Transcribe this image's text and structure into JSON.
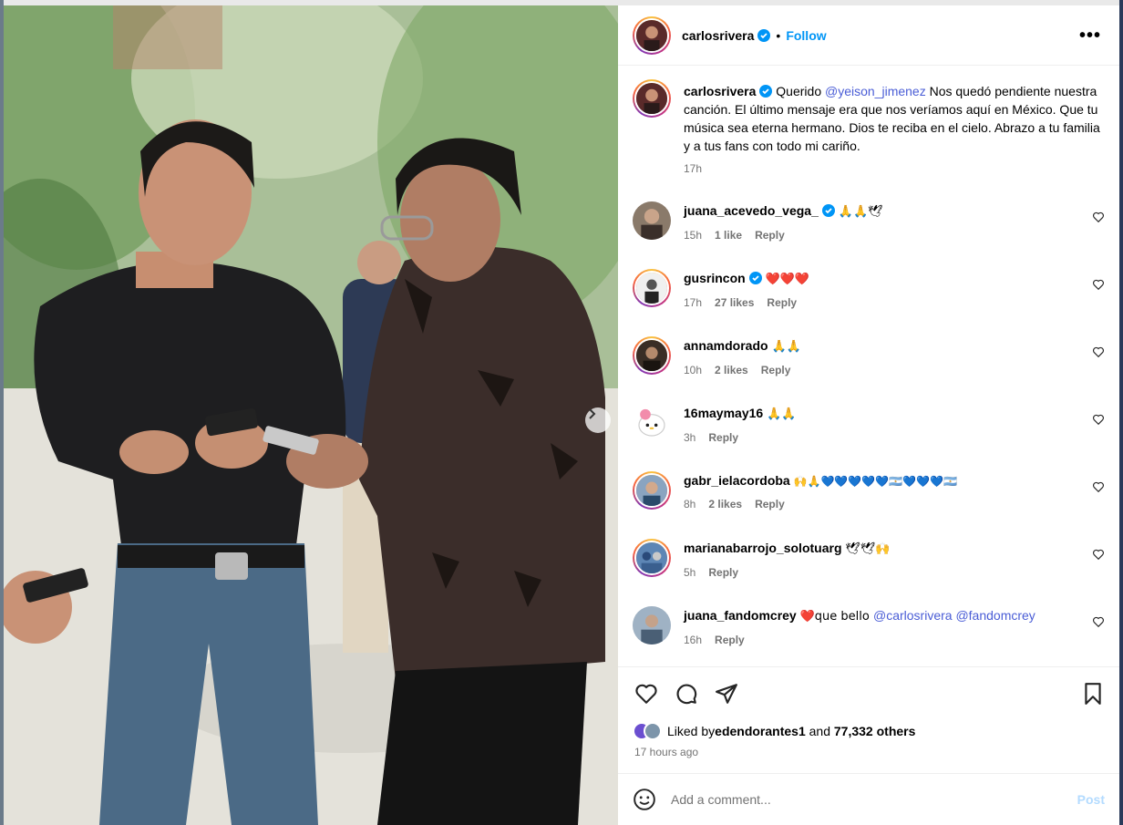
{
  "header": {
    "username": "carlosrivera",
    "separator": "•",
    "follow_label": "Follow",
    "more_label": "•••"
  },
  "caption": {
    "username": "carlosrivera",
    "text_before": "Querido ",
    "mention": "@yeison_jimenez",
    "text_after": " Nos quedó pendiente nuestra canción. El último mensaje era que nos veríamos aquí en México. Que tu música sea eterna hermano. Dios te reciba en el cielo. Abrazo a tu familia y a tus fans con todo mi cariño.",
    "time": "17h"
  },
  "comments": [
    {
      "username": "juana_acevedo_vega_",
      "verified": true,
      "text": "🙏🙏🕊",
      "time": "15h",
      "likes": "1 like",
      "reply": "Reply"
    },
    {
      "username": "gusrincon",
      "verified": true,
      "text": "❤️❤️❤️",
      "time": "17h",
      "likes": "27 likes",
      "reply": "Reply"
    },
    {
      "username": "annamdorado",
      "verified": false,
      "text": "🙏🙏",
      "time": "10h",
      "likes": "2 likes",
      "reply": "Reply"
    },
    {
      "username": "16maymay16",
      "verified": false,
      "text": "🙏🙏",
      "time": "3h",
      "likes": "",
      "reply": "Reply"
    },
    {
      "username": "gabr_ielacordoba",
      "verified": false,
      "text": "🙌🙏💙💙💙💙💙🇦🇷💙💙💙🇦🇷",
      "time": "8h",
      "likes": "2 likes",
      "reply": "Reply"
    },
    {
      "username": "marianabarrojo_solotuarg",
      "verified": false,
      "text": "🕊🕊🙌",
      "time": "5h",
      "likes": "",
      "reply": "Reply"
    },
    {
      "username": "juana_fandomcrey",
      "verified": false,
      "text_before": "❤️que bello ",
      "mention1": "@carlosrivera",
      "mention2": "@fandomcrey",
      "time": "16h",
      "likes": "",
      "reply": "Reply"
    }
  ],
  "likes": {
    "prefix": "Liked by ",
    "user": "edendorantes1",
    "middle": " and ",
    "count": "77,332 others",
    "time_ago": "17 hours ago"
  },
  "add_comment": {
    "placeholder": "Add a comment...",
    "post_label": "Post"
  },
  "colors": {
    "link_blue": "#0095f6",
    "mention": "#00376b",
    "muted": "#737373"
  }
}
